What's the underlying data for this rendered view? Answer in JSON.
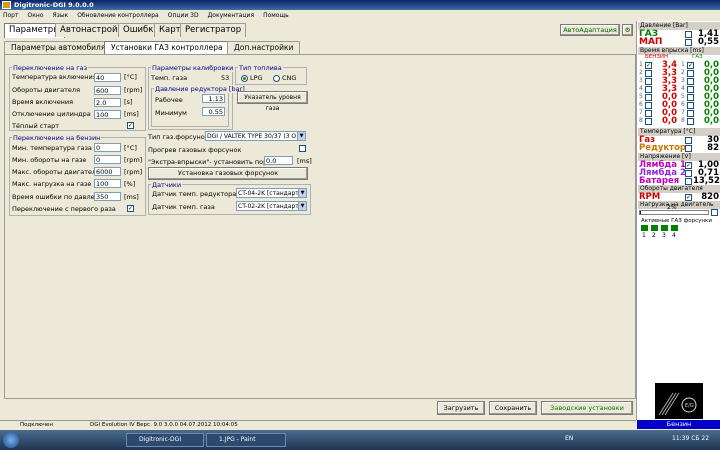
{
  "window": {
    "title": "Digitronic-DGI  9.0.0.0"
  },
  "menu": [
    "Порт",
    "Окно",
    "Язык",
    "Обновление контроллера",
    "Опции 3D",
    "Документация",
    "Помощь"
  ],
  "tabs": [
    "Параметры",
    "Автонастройка",
    "Ошибки",
    "Карта",
    "Регистратор"
  ],
  "active_tab": "Параметры",
  "auto_adapt": "АвтоАдаптация",
  "subtabs": [
    "Параметры автомобиля",
    "Установки ГАЗ контроллера",
    "Доп.настройки"
  ],
  "active_subtab": "Установки ГАЗ контроллера",
  "switch_gas": {
    "title": "Переключение на газ",
    "rows": [
      {
        "label": "Температура включения",
        "value": "40",
        "unit": "[°C]"
      },
      {
        "label": "Обороты двигателя",
        "value": "600",
        "unit": "[rpm]"
      },
      {
        "label": "Время включения",
        "value": "2.0",
        "unit": "[s]"
      },
      {
        "label": "Отключение цилиндра",
        "value": "100",
        "unit": "[ms]"
      }
    ],
    "warm_start": {
      "label": "Тёплый старт",
      "checked": true
    }
  },
  "switch_petrol": {
    "title": "Переключение на бензин",
    "rows": [
      {
        "label": "Мин. температура газа",
        "value": "0",
        "unit": "[°C]"
      },
      {
        "label": "Мин. обороты на газе",
        "value": "0",
        "unit": "[rpm]"
      },
      {
        "label": "Макс. обороты двигателя",
        "value": "6000",
        "unit": "[rpm]"
      },
      {
        "label": "Макс. нагрузка на газе",
        "value": "100",
        "unit": "[%]"
      },
      {
        "label": "Время ошибки по давлению",
        "value": "350",
        "unit": "[ms]"
      }
    ],
    "first_start": {
      "label": "Переключение с первого раза",
      "checked": true
    }
  },
  "calibration": {
    "title": "Параметры калибровки",
    "gas_temp_label": "Темп. газа",
    "gas_temp_value": "53",
    "pressure_title": "Давление редуктора [bar]",
    "working_label": "Рабочее",
    "working_value": "1.13",
    "min_label": "Минимум",
    "min_value": "0.55"
  },
  "fuel_type": {
    "title": "Тип топлива",
    "options": [
      "LPG",
      "CNG"
    ],
    "selected": "LPG"
  },
  "level_btn": "Указатель уровня газа",
  "injector": {
    "type_label": "Тип газ.форсунок",
    "type_value": "DGI / VALTEK TYPE 30/37 (3 O",
    "heating_label": "Прогрев газовых форсунок",
    "extra_label": "\"Экстра-впрыски\"- установить порог",
    "extra_value": "0.0",
    "extra_unit": "[ms]",
    "install_btn": "Установка газовых форсунок"
  },
  "sensors": {
    "title": "Датчики",
    "reducer_label": "Датчик темп. редуктора",
    "reducer_value": "CT-04-2K [стандарт",
    "gas_label": "Датчик темп. газа",
    "gas_value": "CT-02-2K [стандарт"
  },
  "buttons": {
    "load": "Загрузить",
    "save": "Сохранить",
    "factory": "Заводские установки"
  },
  "status": {
    "connection": "Подключен",
    "version": "DGI Evolution IV   Верс. 9.0  3.0.0    04.07.2012 10:04:05"
  },
  "sidebar": {
    "pressure_title": "Давление [Bar]",
    "gas_label": "ГАЗ",
    "gas_value": "1,41",
    "map_label": "МАП",
    "map_value": "0,55",
    "inj_title": "Время впрыска [ms]",
    "petrol_col": "БЕНЗИН",
    "gas_col": "ГАЗ",
    "inj_rows": [
      {
        "n": "1",
        "petrol": "3,4",
        "gas": "0,0",
        "petrol_on": true,
        "gas_on": true
      },
      {
        "n": "2",
        "petrol": "3,3",
        "gas": "0,0",
        "petrol_on": false,
        "gas_on": false
      },
      {
        "n": "3",
        "petrol": "3,3",
        "gas": "0,0",
        "petrol_on": false,
        "gas_on": false
      },
      {
        "n": "4",
        "petrol": "3,3",
        "gas": "0,0",
        "petrol_on": false,
        "gas_on": false
      },
      {
        "n": "5",
        "petrol": "0,0",
        "gas": "0,0",
        "petrol_on": false,
        "gas_on": false
      },
      {
        "n": "6",
        "petrol": "0,0",
        "gas": "0,0",
        "petrol_on": false,
        "gas_on": false
      },
      {
        "n": "7",
        "petrol": "0,0",
        "gas": "0,0",
        "petrol_on": false,
        "gas_on": false
      },
      {
        "n": "8",
        "petrol": "0,0",
        "gas": "0,0",
        "petrol_on": false,
        "gas_on": false
      }
    ],
    "temp_title": "Температура [°C]",
    "gas_t_label": "Газ",
    "gas_t_value": "30",
    "reducer_label": "Редуктор",
    "reducer_value": "82",
    "voltage_title": "Напряжение [V]",
    "lambda1_label": "Лямбда 1",
    "lambda1_value": "1,00",
    "lambda2_label": "Лямбда 2",
    "lambda2_value": "0,71",
    "battery_label": "Батарея",
    "battery_value": "13,52",
    "rpm_title": "Обороты двигателя",
    "rpm_label": "RPM",
    "rpm_value": "820",
    "load_title": "Нагрузка на двигатель",
    "load_value": "2%",
    "load_fraction": 0.02,
    "active_title": "Активные ГАЗ форсунки",
    "active_nums": [
      "1",
      "2",
      "3",
      "4"
    ],
    "fuel_status": "Бензин"
  },
  "taskbar": {
    "task1": "Digitronic-DGI",
    "task2": "1.JPG - Paint",
    "lang": "EN",
    "clock": "11:39 CБ 22"
  },
  "colors": {
    "gas": "#008000",
    "petrol": "#d20000",
    "label_blue": "#00008b",
    "status_blue": "#0000c8"
  }
}
